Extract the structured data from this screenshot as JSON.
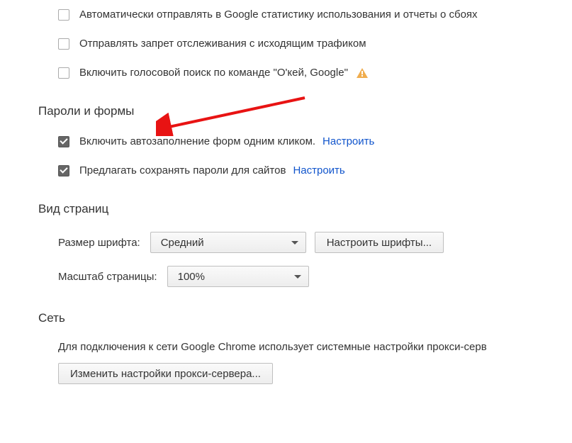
{
  "privacy": {
    "opt_stats": "Автоматически отправлять в Google статистику использования и отчеты о сбоях",
    "opt_dnt": "Отправлять запрет отслеживания с исходящим трафиком",
    "opt_voice": "Включить голосовой поиск по команде \"О'кей, Google\""
  },
  "passwords": {
    "heading": "Пароли и формы",
    "opt_autofill": "Включить автозаполнение форм одним кликом.",
    "opt_savepw": "Предлагать сохранять пароли для сайтов",
    "configure": "Настроить"
  },
  "appearance": {
    "heading": "Вид страниц",
    "font_size_label": "Размер шрифта:",
    "font_size_value": "Средний",
    "customize_fonts": "Настроить шрифты...",
    "zoom_label": "Масштаб страницы:",
    "zoom_value": "100%"
  },
  "network": {
    "heading": "Сеть",
    "desc": "Для подключения к сети Google Chrome использует системные настройки прокси-серв",
    "proxy_btn": "Изменить настройки прокси-сервера..."
  }
}
